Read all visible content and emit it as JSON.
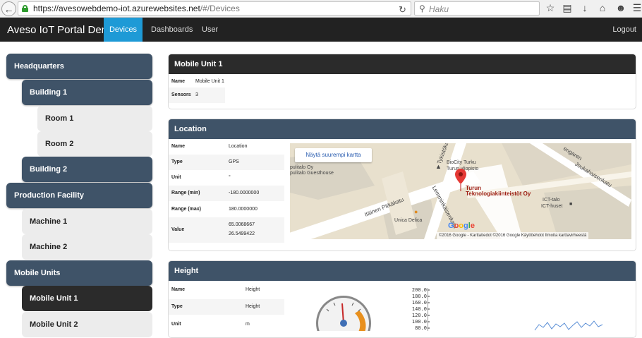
{
  "browser": {
    "url_host": "https://avesowebdemo-iot.azurewebsites.net",
    "url_path": "/#/Devices",
    "search_placeholder": "Haku"
  },
  "navbar": {
    "brand": "Aveso IoT Portal Demo",
    "items": [
      "Devices",
      "Dashboards",
      "User"
    ],
    "active": "Devices",
    "logout": "Logout"
  },
  "sidebar": {
    "nodes": [
      {
        "label": "Headquarters",
        "level": 0
      },
      {
        "label": "Building 1",
        "level": 1
      },
      {
        "label": "Room 1",
        "level": 2
      },
      {
        "label": "Room 2",
        "level": 2
      },
      {
        "label": "Building 2",
        "level": 1
      },
      {
        "label": "Production Facility",
        "level": 0
      },
      {
        "label": "Machine 1",
        "level": 1
      },
      {
        "label": "Machine 2",
        "level": 1
      },
      {
        "label": "Mobile Units",
        "level": 0
      },
      {
        "label": "Mobile Unit 1",
        "level": 1,
        "selected": true
      },
      {
        "label": "Mobile Unit 2",
        "level": 1
      }
    ]
  },
  "device": {
    "title": "Mobile Unit 1",
    "fields": [
      {
        "key": "Name",
        "value": "Mobile Unit 1"
      },
      {
        "key": "Sensors",
        "value": "3"
      }
    ]
  },
  "location": {
    "title": "Location",
    "fields": [
      {
        "key": "Name",
        "value": "Location"
      },
      {
        "key": "Type",
        "value": "GPS"
      },
      {
        "key": "Unit",
        "value": "°"
      },
      {
        "key": "Range (min)",
        "value": "-180.0000000"
      },
      {
        "key": "Range (max)",
        "value": "180.0000000"
      },
      {
        "key": "Value",
        "value": "65.0068667",
        "value2": "26.5499422"
      }
    ],
    "map": {
      "button": "Näytä suurempi kartta",
      "labels": {
        "biocity": "BioCity Turku",
        "biocity2": "Turun yliopisto",
        "pulitalo": "pulitalo Oy",
        "guesthouse": "pulitalo Guesthouse",
        "marker1": "Turun",
        "marker2": "Teknologiakiinteistöt Oy",
        "ict1": "ICT-talo",
        "ict2": "ICT-huset",
        "unica": "Unica Delica",
        "street1": "Itäinen Pitkäkatu",
        "street2": "Lemminkäisenkatu",
        "street3": "Tykistökatu",
        "street4": "Joukahaisenkatu",
        "street5": "engaren"
      },
      "attribution": "©2016 Google - Karttatiedot ©2016 Google    Käyttöehdot    Ilmoita karttavirheestä",
      "google": [
        "G",
        "o",
        "o",
        "g",
        "l",
        "e"
      ]
    }
  },
  "height": {
    "title": "Height",
    "fields": [
      {
        "key": "Name",
        "value": "Height"
      },
      {
        "key": "Type",
        "value": "Height"
      },
      {
        "key": "Unit",
        "value": "m"
      }
    ],
    "chart_y_ticks": [
      "200.0",
      "180.0",
      "160.0",
      "140.0",
      "120.0",
      "100.0",
      "80.0"
    ]
  }
}
